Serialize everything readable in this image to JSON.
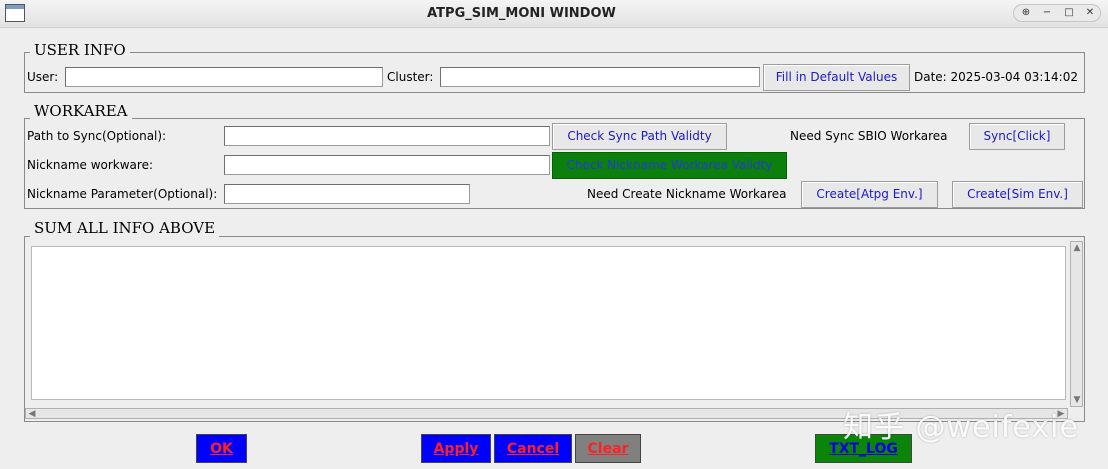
{
  "window": {
    "title": "ATPG_SIM_MONI WINDOW",
    "controls": {
      "up": "⊕",
      "minimize": "−",
      "maximize": "□",
      "close": "✕"
    }
  },
  "user_info": {
    "legend": "USER INFO",
    "user_label": "User:",
    "user_value": "",
    "cluster_label": "Cluster:",
    "cluster_value": "",
    "fill_button": "Fill in Default Values",
    "date_text": "Date: 2025-03-04 03:14:02"
  },
  "workarea": {
    "legend": "WORKAREA",
    "path_label": "Path to Sync(Optional):",
    "path_value": "",
    "check_sync_button": "Check Sync Path Validty",
    "need_sync_label": "Need Sync SBIO Workarea",
    "sync_button": "Sync[Click]",
    "nickname_label": "Nickname workware:",
    "nickname_value": "",
    "check_nickname_button": "Check Nickname Workarea Validty",
    "param_label": "Nickname Parameter(Optional):",
    "param_value": "",
    "need_create_label": "Need Create Nickname Workarea",
    "create_atpg_button": "Create[Atpg Env.]",
    "create_sim_button": "Create[Sim Env.]"
  },
  "summary": {
    "legend": "SUM ALL INFO ABOVE",
    "text": ""
  },
  "footer": {
    "ok": "OK",
    "apply": "Apply",
    "cancel": "Cancel",
    "clear": "Clear",
    "txt_log": "TXT_LOG"
  },
  "watermark": "知乎 @weifexie",
  "colors": {
    "accent_blue": "#0000ff",
    "accent_green": "#0a850a",
    "accent_grey": "#808080",
    "label_red": "#ff2020"
  }
}
